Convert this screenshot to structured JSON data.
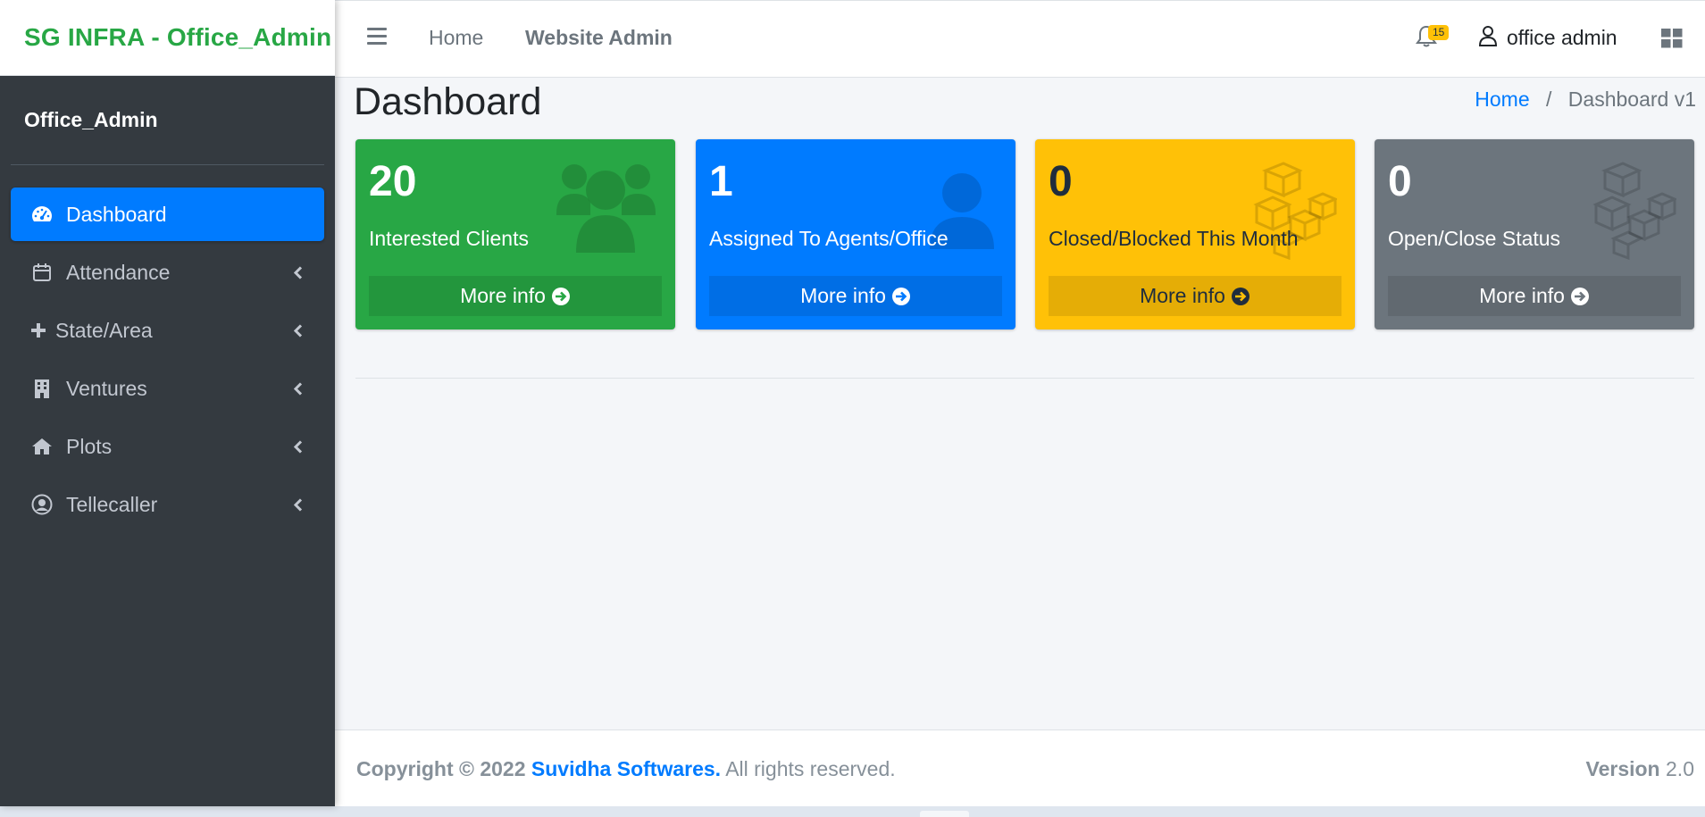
{
  "brand": {
    "title": "SG INFRA - Office_Admin",
    "color": "#28a745"
  },
  "user_panel": {
    "name": "Office_Admin"
  },
  "sidebar": {
    "items": [
      {
        "label": "Dashboard",
        "icon": "tachometer-icon",
        "active": true
      },
      {
        "label": "Attendance",
        "icon": "calendar-icon"
      },
      {
        "label": "State/Area",
        "icon": "plus-icon"
      },
      {
        "label": "Ventures",
        "icon": "building-icon"
      },
      {
        "label": "Plots",
        "icon": "home-icon"
      },
      {
        "label": "Tellecaller",
        "icon": "user-circle-icon"
      }
    ]
  },
  "topbar": {
    "links": [
      "Home",
      "Website Admin"
    ],
    "notifications_count": "15",
    "user_name": "office admin"
  },
  "content": {
    "title": "Dashboard",
    "breadcrumb": {
      "home": "Home",
      "separator": "/",
      "current": "Dashboard v1"
    }
  },
  "boxes": [
    {
      "count": "20",
      "label": "Interested Clients",
      "footer": "More info",
      "color": "#28a745",
      "icon": "users-icon"
    },
    {
      "count": "1",
      "label": "Assigned To Agents/Office",
      "footer": "More info",
      "color": "#007bff",
      "icon": "user-icon"
    },
    {
      "count": "0",
      "label": "Closed/Blocked This Month",
      "footer": "More info",
      "color": "#ffc107",
      "icon": "cubes-icon"
    },
    {
      "count": "0",
      "label": "Open/Close Status",
      "footer": "More info",
      "color": "#6c757d",
      "icon": "cubes-icon"
    }
  ],
  "footer": {
    "copyright": "Copyright © 2022",
    "company": "Suvidha Softwares.",
    "rights": "All rights reserved.",
    "version_label": "Version",
    "version": "2.0"
  },
  "colors": {
    "sidebar_bg": "#343a40",
    "active": "#007bff",
    "badge": "#ffc107",
    "page_bg": "#f4f6f9"
  }
}
